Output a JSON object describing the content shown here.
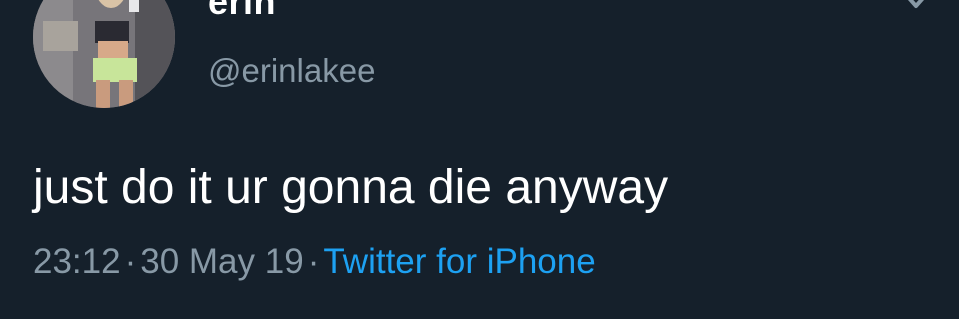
{
  "tweet": {
    "author": {
      "display_name": "erin",
      "handle": "@erinlakee",
      "avatar_icon": "profile-photo"
    },
    "text": "just do it ur gonna die anyway",
    "time": "23:12",
    "date": "30 May 19",
    "separator": "·",
    "source": "Twitter for iPhone",
    "menu_icon": "chevron-down-icon"
  },
  "colors": {
    "background": "#15202b",
    "text": "#ffffff",
    "secondary_text": "#8899a6",
    "link": "#1da1f2"
  }
}
